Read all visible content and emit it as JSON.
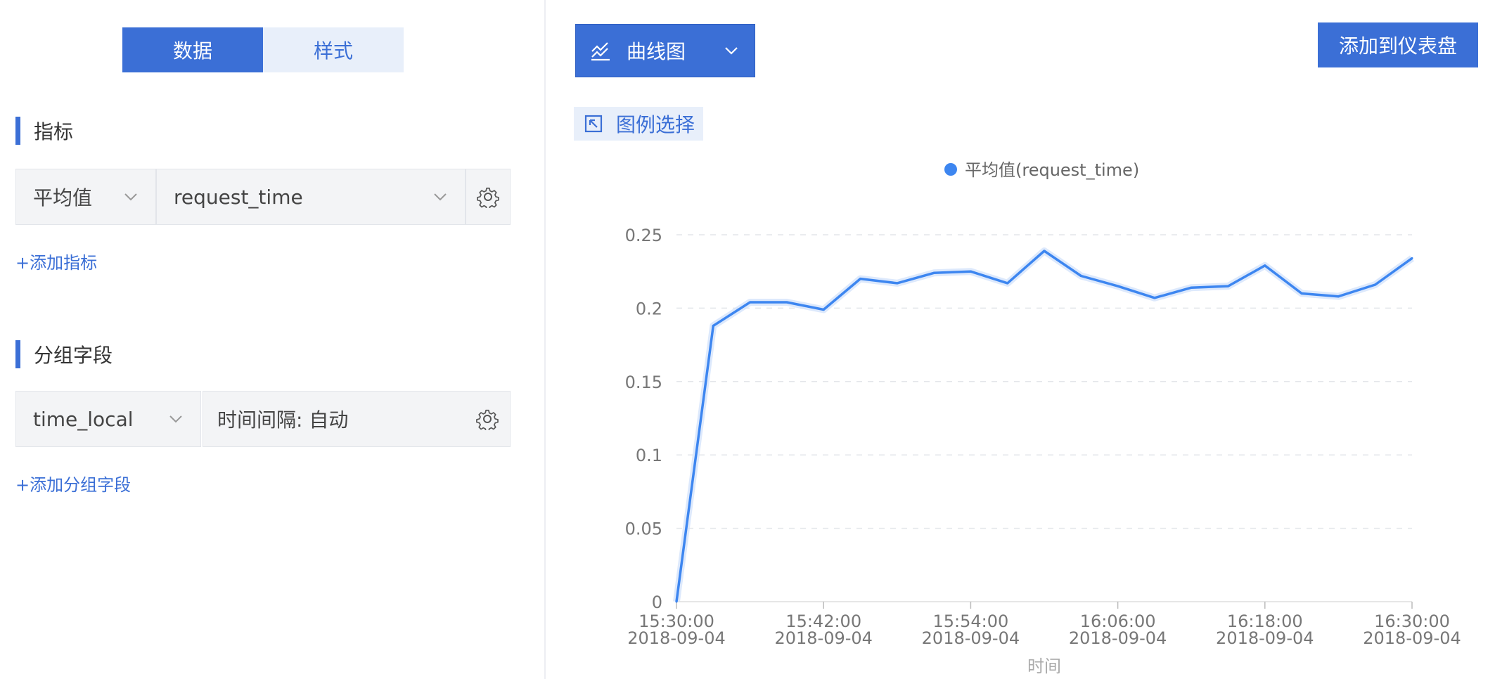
{
  "tabs": {
    "data": "数据",
    "style": "样式"
  },
  "metrics": {
    "title": "指标",
    "aggregation": "平均值",
    "field": "request_time",
    "add_link": "+添加指标"
  },
  "group": {
    "title": "分组字段",
    "field": "time_local",
    "interval": "时间间隔: 自动",
    "add_link": "+添加分组字段"
  },
  "toolbar": {
    "chart_type": "曲线图",
    "add_dashboard": "添加到仪表盘",
    "legend_select": "图例选择"
  },
  "colors": {
    "accent": "#3b6fd6",
    "line": "#3d86f0"
  },
  "chart_data": {
    "type": "line",
    "title": "",
    "xlabel": "时间",
    "ylabel": "",
    "legend": "top-center",
    "grid": true,
    "ylim": [
      0,
      0.25
    ],
    "yticks": [
      "0",
      "0.05",
      "0.1",
      "0.15",
      "0.2",
      "0.25"
    ],
    "xticks": [
      {
        "time": "15:30:00",
        "date": "2018-09-04"
      },
      {
        "time": "15:42:00",
        "date": "2018-09-04"
      },
      {
        "time": "15:54:00",
        "date": "2018-09-04"
      },
      {
        "time": "16:06:00",
        "date": "2018-09-04"
      },
      {
        "time": "16:18:00",
        "date": "2018-09-04"
      },
      {
        "time": "16:30:00",
        "date": "2018-09-04"
      }
    ],
    "x": [
      "15:30",
      "15:33",
      "15:36",
      "15:39",
      "15:42",
      "15:45",
      "15:48",
      "15:51",
      "15:54",
      "15:57",
      "16:00",
      "16:03",
      "16:06",
      "16:09",
      "16:12",
      "16:15",
      "16:18",
      "16:21",
      "16:24",
      "16:27",
      "16:30"
    ],
    "series": [
      {
        "name": "平均值(request_time)",
        "values": [
          0.0,
          0.188,
          0.204,
          0.204,
          0.199,
          0.22,
          0.217,
          0.224,
          0.225,
          0.217,
          0.239,
          0.222,
          0.215,
          0.207,
          0.214,
          0.215,
          0.229,
          0.21,
          0.208,
          0.216,
          0.234
        ]
      }
    ]
  }
}
